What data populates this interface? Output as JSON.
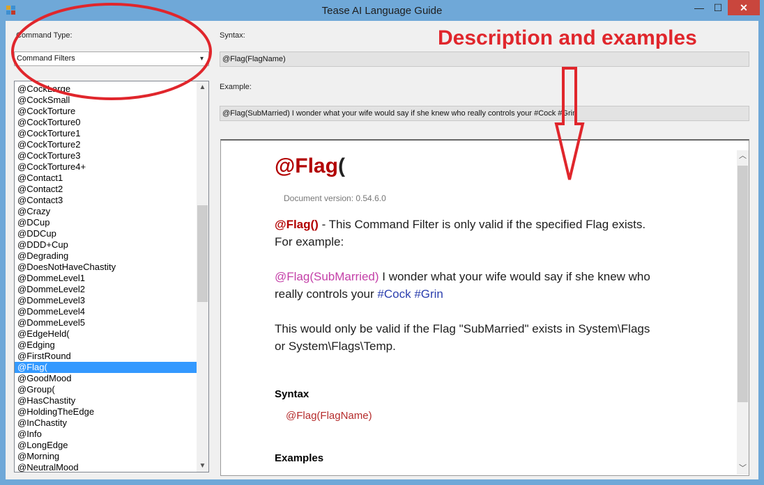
{
  "window": {
    "title": "Tease AI Language Guide",
    "minimize_glyph": "—",
    "maximize_glyph": "☐",
    "close_glyph": "✕"
  },
  "command_type": {
    "label": "Command Type:",
    "selected": "Command Filters"
  },
  "command_list": {
    "items": [
      "@CockLarge",
      "@CockSmall",
      "@CockTorture",
      "@CockTorture0",
      "@CockTorture1",
      "@CockTorture2",
      "@CockTorture3",
      "@CockTorture4+",
      "@Contact1",
      "@Contact2",
      "@Contact3",
      "@Crazy",
      "@DCup",
      "@DDCup",
      "@DDD+Cup",
      "@Degrading",
      "@DoesNotHaveChastity",
      "@DommeLevel1",
      "@DommeLevel2",
      "@DommeLevel3",
      "@DommeLevel4",
      "@DommeLevel5",
      "@EdgeHeld(",
      "@Edging",
      "@FirstRound",
      "@Flag(",
      "@GoodMood",
      "@Group(",
      "@HasChastity",
      "@HoldingTheEdge",
      "@InChastity",
      "@Info",
      "@LongEdge",
      "@Morning",
      "@NeutralMood"
    ],
    "selected_index": 25
  },
  "syntax": {
    "label": "Syntax:",
    "value": "@Flag(FlagName)"
  },
  "example": {
    "label": "Example:",
    "value": "@Flag(SubMarried) I wonder what your wife would say if she knew who really controls your #Cock #Grin"
  },
  "doc": {
    "heading_name": "@Flag",
    "heading_paren": "(",
    "version": "Document version: 0.54.6.0",
    "intro_filter": "@Flag()",
    "intro_text": " - This Command Filter is only valid if the specified Flag exists.",
    "intro_text2": "For example:",
    "example_filter": "@Flag(SubMarried)",
    "example_text": " I wonder what your wife would say if she knew who",
    "example_text2": "really controls your ",
    "example_vocab1": "#Cock",
    "example_vocab2": "#Grin",
    "valid_text": "This would only be valid if the Flag \"SubMarried\" exists in System\\Flags",
    "valid_text2": "or System\\Flags\\Temp.",
    "syntax_heading": "Syntax",
    "syntax_value": "@Flag(FlagName)",
    "examples_heading": "Examples"
  },
  "annotation": {
    "text": "Description and examples",
    "color": "#e0262c"
  },
  "colors": {
    "titlebar": "#6fa8d8",
    "selection": "#3399ff",
    "close_button": "#c9463d",
    "filter_red": "#b20000",
    "filter_pink": "#c440a8",
    "vocab_blue": "#2b3fae"
  },
  "icons": {
    "combo_arrow": "▾",
    "scroll_up": "▲",
    "scroll_down": "▼",
    "browser_up": "︿",
    "browser_down": "﹀"
  }
}
